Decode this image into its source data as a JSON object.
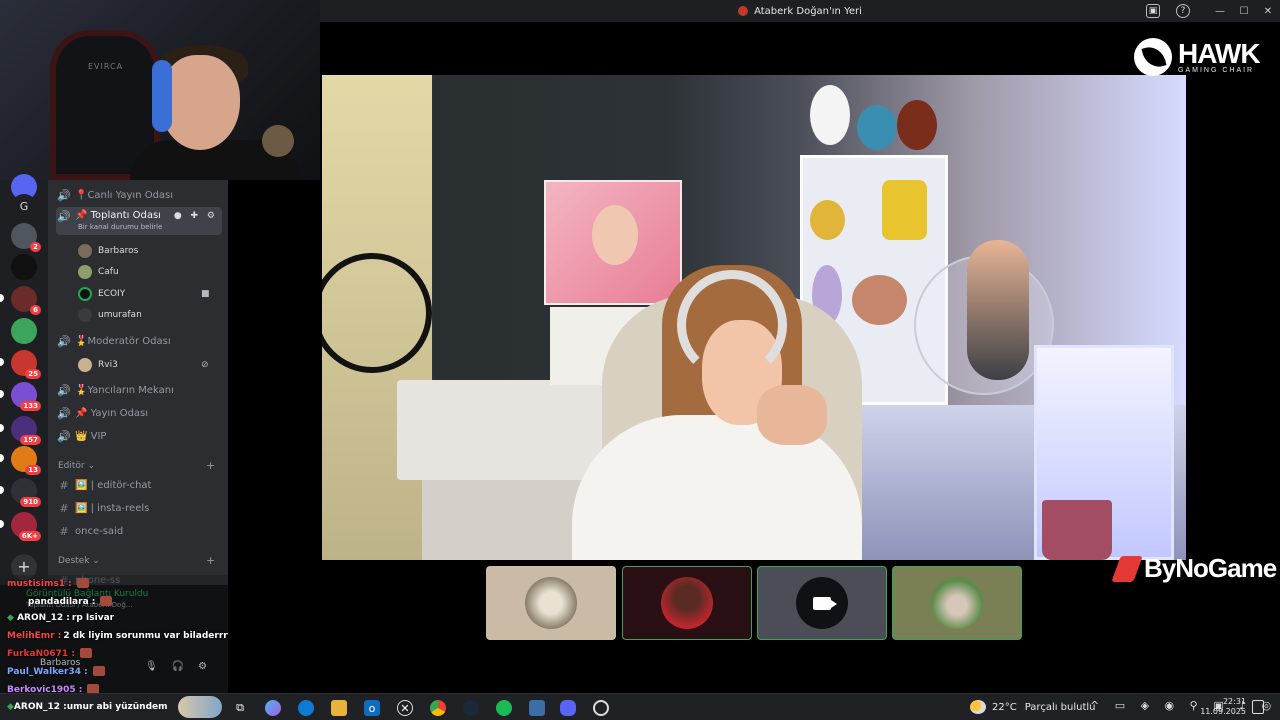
{
  "window": {
    "title": "Ataberk Doğan'ın Yeri",
    "controls": [
      "—",
      "☐",
      "✕"
    ]
  },
  "webcam": {
    "chair_text": "EVIRCA"
  },
  "servers": {
    "badges": [
      "2",
      "6",
      "25",
      "133",
      "157",
      "13",
      "910",
      "6K+"
    ]
  },
  "channels": {
    "items": [
      {
        "label": "📍Canlı Yayın Odası"
      },
      {
        "label": "📌 Toplantı Odası",
        "status": "Bir kanal durumu belirle"
      },
      {
        "label": "🎖️Moderatör Odası"
      },
      {
        "label": "🎖️Yancıların Mekanı"
      },
      {
        "label": "📌 Yayın Odası"
      },
      {
        "label": "👑 VIP"
      },
      {
        "label": "🖼️ | editör-chat"
      },
      {
        "label": "🖼️ | insta-reels"
      },
      {
        "label": "once-said"
      }
    ],
    "members_meeting": [
      "Barbaros",
      "Cafu",
      "ECOIY",
      "umurafan"
    ],
    "members_moderator": [
      "Rvi3"
    ],
    "categories": {
      "editor": "Editör",
      "support": "Destek"
    },
    "support_partial": "phone-ss"
  },
  "voice": {
    "status": "Görüntülü Bağlantı Kuruldu",
    "channel": "Toplantı Odası / Ataberk Doğ...",
    "user": "Barbaros"
  },
  "chat": {
    "messages": [
      {
        "user": "mustisims1 :",
        "text": "",
        "color": "#f04747"
      },
      {
        "user": "pandadilara :",
        "text": "",
        "color": "#ffffff"
      },
      {
        "user": "ARON_12 :",
        "text": "rp Isivar",
        "color": "#ffffff"
      },
      {
        "user": "MelihEmr :",
        "text": "2 dk liyim sorunmu var biladerrr",
        "color": "#f04747"
      },
      {
        "user": "FurkaN0671 :",
        "text": "",
        "color": "#e53935"
      },
      {
        "user": "Paul_Walker34 :",
        "text": "",
        "color": "#7ea6ff"
      },
      {
        "user": "Berkovic1905 :",
        "text": "",
        "color": "#c78cff"
      }
    ],
    "ticker_user": "ARON_12 :",
    "ticker_text": "umur abi yüzündem"
  },
  "logos": {
    "hawk_name": "HAWK",
    "hawk_sub": "GAMING CHAIR",
    "bynogame": "ByNoGame"
  },
  "taskbar": {
    "temperature": "22°C",
    "condition": "Parçalı bulutlu",
    "time": "22:31",
    "date": "11.09.2025"
  }
}
